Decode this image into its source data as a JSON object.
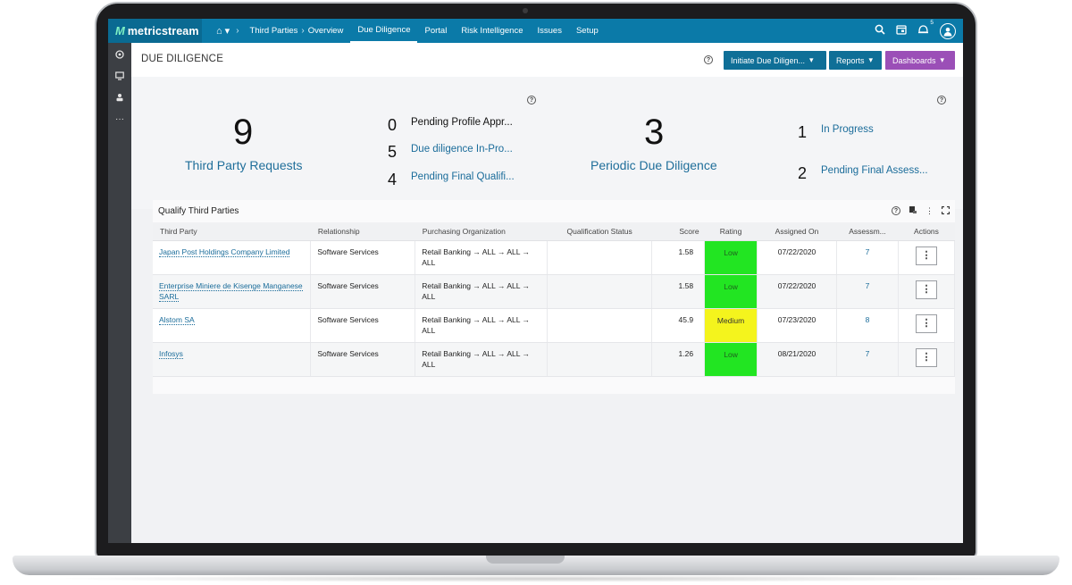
{
  "app": {
    "logo_text": "metricstream"
  },
  "nav": {
    "home_label": "▾",
    "items": [
      "Third Parties",
      "Overview",
      "Due Diligence",
      "Portal",
      "Risk Intelligence",
      "Issues",
      "Setup"
    ],
    "notification_count": "5"
  },
  "page": {
    "title": "DUE DILIGENCE"
  },
  "header_buttons": {
    "initiate": "Initiate Due Diligen...",
    "reports": "Reports",
    "dashboards": "Dashboards"
  },
  "summary": {
    "third_party_requests": {
      "count": "9",
      "label": "Third Party Requests"
    },
    "request_breakdown": [
      {
        "count": "0",
        "label": "Pending Profile Appr..."
      },
      {
        "count": "5",
        "label": "Due diligence In-Pro..."
      },
      {
        "count": "4",
        "label": "Pending Final Qualifi..."
      }
    ],
    "periodic": {
      "count": "3",
      "label": "Periodic Due Diligence"
    },
    "periodic_breakdown": [
      {
        "count": "1",
        "label": "In Progress"
      },
      {
        "count": "2",
        "label": "Pending Final Assess..."
      }
    ]
  },
  "qualify": {
    "title": "Qualify Third Parties",
    "columns": [
      "Third Party",
      "Relationship",
      "Purchasing Organization",
      "Qualification Status",
      "Score",
      "Rating",
      "Assigned On",
      "Assessm...",
      "Actions"
    ],
    "rows": [
      {
        "third_party": "Japan Post Holdings Company Limited",
        "relationship": "Software Services",
        "org": "Retail Banking → ALL → ALL → ALL",
        "status": "",
        "score": "1.58",
        "rating": "Low",
        "assigned": "07/22/2020",
        "assessments": "7"
      },
      {
        "third_party": "Enterprise Miniere de Kisenge Manganese SARL",
        "relationship": "Software Services",
        "org": "Retail Banking → ALL → ALL → ALL",
        "status": "",
        "score": "1.58",
        "rating": "Low",
        "assigned": "07/22/2020",
        "assessments": "7"
      },
      {
        "third_party": "Alstom SA",
        "relationship": "Software Services",
        "org": "Retail Banking → ALL → ALL → ALL",
        "status": "",
        "score": "45.9",
        "rating": "Medium",
        "assigned": "07/23/2020",
        "assessments": "8"
      },
      {
        "third_party": "Infosys",
        "relationship": "Software Services",
        "org": "Retail Banking → ALL → ALL → ALL",
        "status": "",
        "score": "1.26",
        "rating": "Low",
        "assigned": "08/21/2020",
        "assessments": "7"
      }
    ]
  },
  "colors": {
    "nav_bg": "#0b7aa8",
    "accent_link": "#1a6c9a",
    "rating_low": "#22e522",
    "rating_medium": "#f4f41d",
    "dashboards_btn": "#9b4fb7"
  },
  "icons": [
    "home-icon",
    "search-icon",
    "calendar-icon",
    "notification-icon",
    "user-avatar-icon",
    "help-icon",
    "export-icon",
    "more-icon",
    "expand-icon"
  ]
}
